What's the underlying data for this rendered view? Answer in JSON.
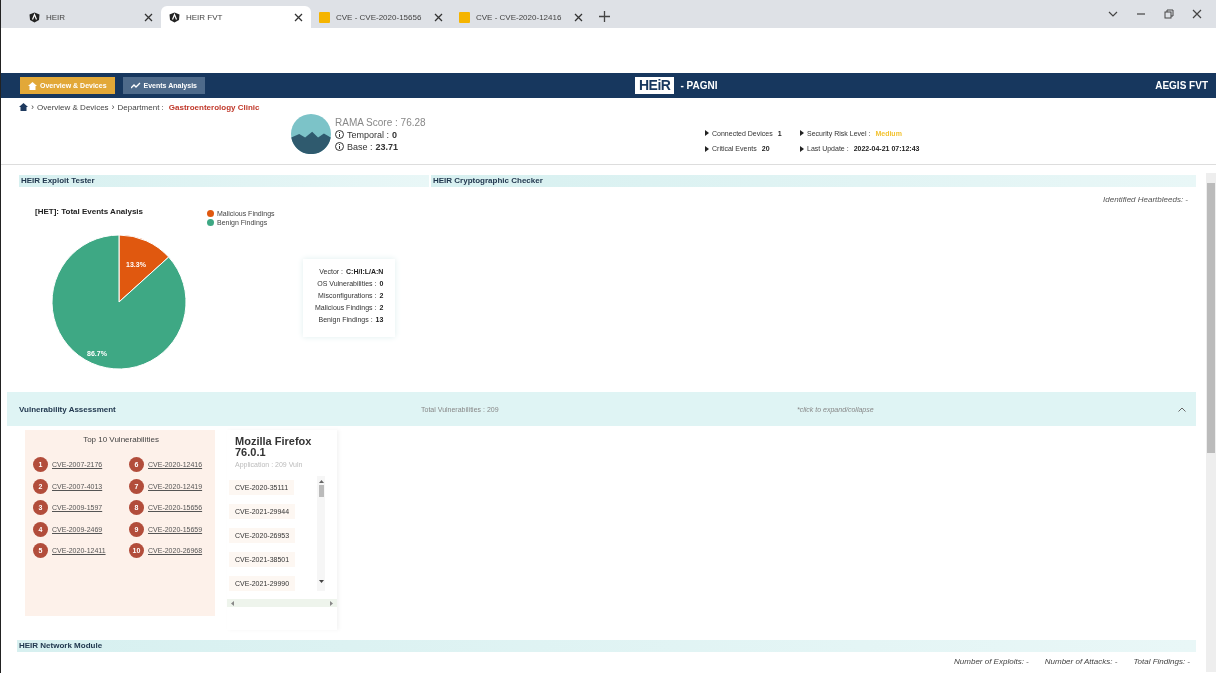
{
  "browser": {
    "tabs": [
      {
        "title": "HEIR",
        "kind": "app",
        "selected": false
      },
      {
        "title": "HEIR FVT",
        "kind": "app",
        "selected": true
      },
      {
        "title": "CVE - CVE-2020-15656",
        "kind": "page",
        "selected": false
      },
      {
        "title": "CVE - CVE-2020-12416",
        "kind": "page",
        "selected": false
      }
    ]
  },
  "navbar": {
    "buttons": [
      {
        "label": "Overview & Devices",
        "kind": "home",
        "selected": true
      },
      {
        "label": "Events Analysis",
        "kind": "trend",
        "selected": false
      }
    ],
    "logo": "HEiR",
    "app_name": "- PAGNI",
    "user": "AEGIS FVT"
  },
  "breadcrumb": {
    "separator": "›",
    "items": [
      "Overview & Devices",
      "Department :"
    ],
    "current": "Gastroenterology Clinic"
  },
  "score": {
    "title": "RAMA Score : 76.28",
    "rows": [
      {
        "label": "Temporal :",
        "value": "0"
      },
      {
        "label": "Base :",
        "value": "23.71"
      }
    ]
  },
  "stats": [
    {
      "label": "Connected Devices",
      "value": "1"
    },
    {
      "label": "Security Risk Level :",
      "value": "Medium",
      "color": "#f2c230"
    },
    {
      "label": "Critical Events",
      "value": "20"
    },
    {
      "label": "Last Update :",
      "value": "2022-04-21 07:12:43"
    }
  ],
  "exploit_tester": {
    "title": "HEIR Exploit Tester",
    "chart_data": {
      "type": "pie",
      "title": "[HET]: Total Events Analysis",
      "categories": [
        "Malicious Findings",
        "Benign Findings"
      ],
      "values": [
        13.3,
        86.7
      ],
      "colors": [
        "#e0580f",
        "#3ea884"
      ],
      "value_labels": [
        "13.3%",
        "86.7%"
      ],
      "legend": "right"
    },
    "summary": [
      {
        "label": "Vector :",
        "value": "C:H/I:L/A:N"
      },
      {
        "label": "OS Vulnerabilities :",
        "value": "0"
      },
      {
        "label": "Misconfigurations :",
        "value": "2"
      },
      {
        "label": "Malicious Findings :",
        "value": "2"
      },
      {
        "label": "Benign Findings :",
        "value": "13"
      }
    ]
  },
  "crypto_checker": {
    "title": "HEIR Cryptographic Checker",
    "heartbleeds": "Identified Heartbleeds: -"
  },
  "vulnerability": {
    "title": "Vulnerability Assessment",
    "total": "Total Vulnerabilities : 209",
    "hint": "*click to expand/collapse",
    "expanded": true,
    "top_title": "Top 10 Vulnerabilities",
    "top": [
      {
        "rank": "1",
        "id": "CVE-2007-2176"
      },
      {
        "rank": "2",
        "id": "CVE-2007-4013"
      },
      {
        "rank": "3",
        "id": "CVE-2009-1597"
      },
      {
        "rank": "4",
        "id": "CVE-2009-2469"
      },
      {
        "rank": "5",
        "id": "CVE-2020-12411"
      },
      {
        "rank": "6",
        "id": "CVE-2020-12416"
      },
      {
        "rank": "7",
        "id": "CVE-2020-12419"
      },
      {
        "rank": "8",
        "id": "CVE-2020-15656"
      },
      {
        "rank": "9",
        "id": "CVE-2020-15659"
      },
      {
        "rank": "10",
        "id": "CVE-2020-26968"
      }
    ],
    "app": {
      "name": "Mozilla Firefox 76.0.1",
      "subtitle": "Application : 209 Vuln",
      "cves": [
        "CVE-2020-35111",
        "CVE-2021-29944",
        "CVE-2020-26953",
        "CVE-2021-38501",
        "CVE-2021-29990"
      ]
    }
  },
  "network": {
    "title": "HEIR Network Module",
    "stats": [
      "Number of Exploits: -",
      "Number of Attacks: -",
      "Total Findings: -"
    ]
  }
}
